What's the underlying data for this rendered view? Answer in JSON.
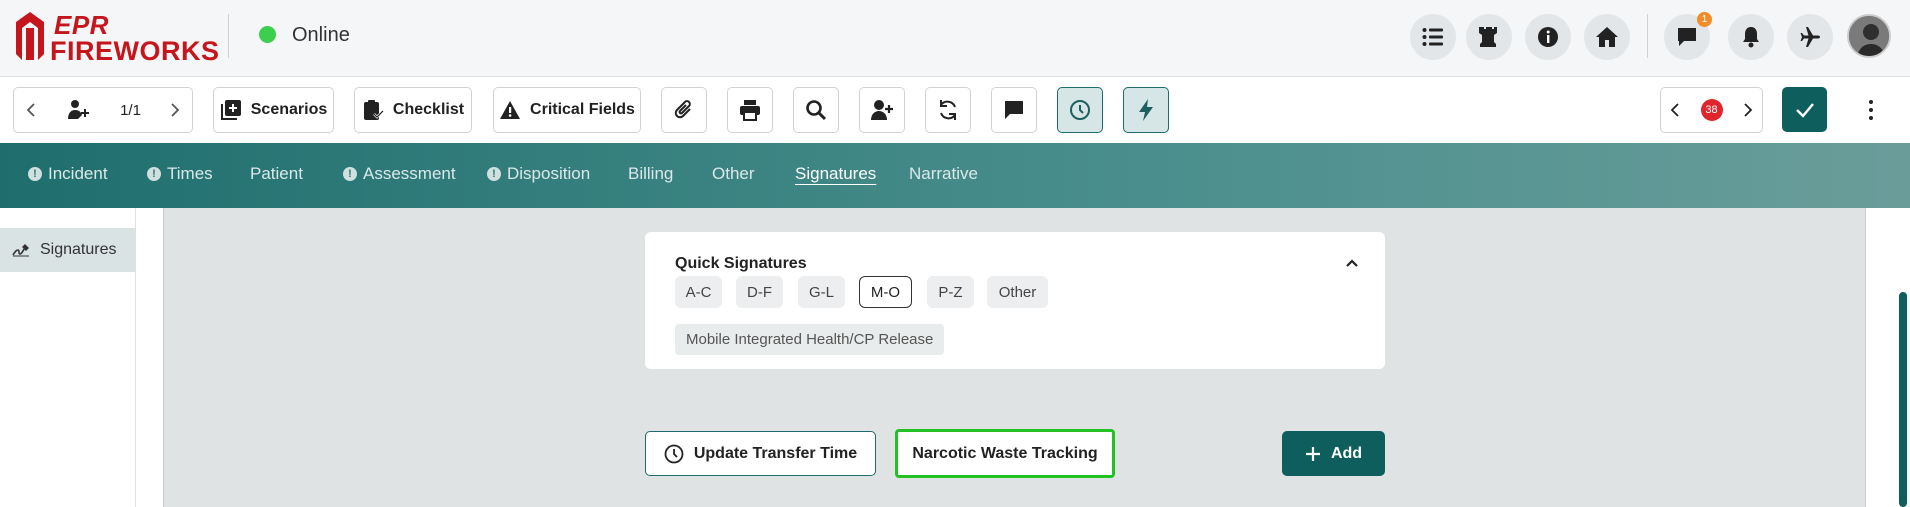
{
  "header": {
    "logo_line1": "EPR",
    "logo_line2": "FIREWORKS",
    "status": "Online",
    "messages_badge": "1"
  },
  "toolbar": {
    "pager": "1/1",
    "scenarios": "Scenarios",
    "checklist": "Checklist",
    "critical_fields": "Critical Fields",
    "issues_count": "38"
  },
  "tabs": [
    {
      "label": "Incident",
      "warn": true
    },
    {
      "label": "Times",
      "warn": true
    },
    {
      "label": "Patient",
      "warn": false
    },
    {
      "label": "Assessment",
      "warn": true
    },
    {
      "label": "Disposition",
      "warn": true
    },
    {
      "label": "Billing",
      "warn": false
    },
    {
      "label": "Other",
      "warn": false
    },
    {
      "label": "Signatures",
      "warn": false,
      "active": true
    },
    {
      "label": "Narrative",
      "warn": false
    }
  ],
  "sidebar": {
    "item": "Signatures"
  },
  "quick_signatures": {
    "title": "Quick Signatures",
    "filters": [
      "A-C",
      "D-F",
      "G-L",
      "M-O",
      "P-Z",
      "Other"
    ],
    "selected_filter": "M-O",
    "options": [
      "Mobile Integrated Health/CP Release"
    ]
  },
  "actions": {
    "update_transfer": "Update Transfer Time",
    "narcotic_waste": "Narcotic Waste Tracking",
    "add": "Add"
  },
  "colors": {
    "brand_red": "#c4161c",
    "teal": "#0f5e5e",
    "online": "#3ccf4e",
    "highlight": "#22c224"
  }
}
